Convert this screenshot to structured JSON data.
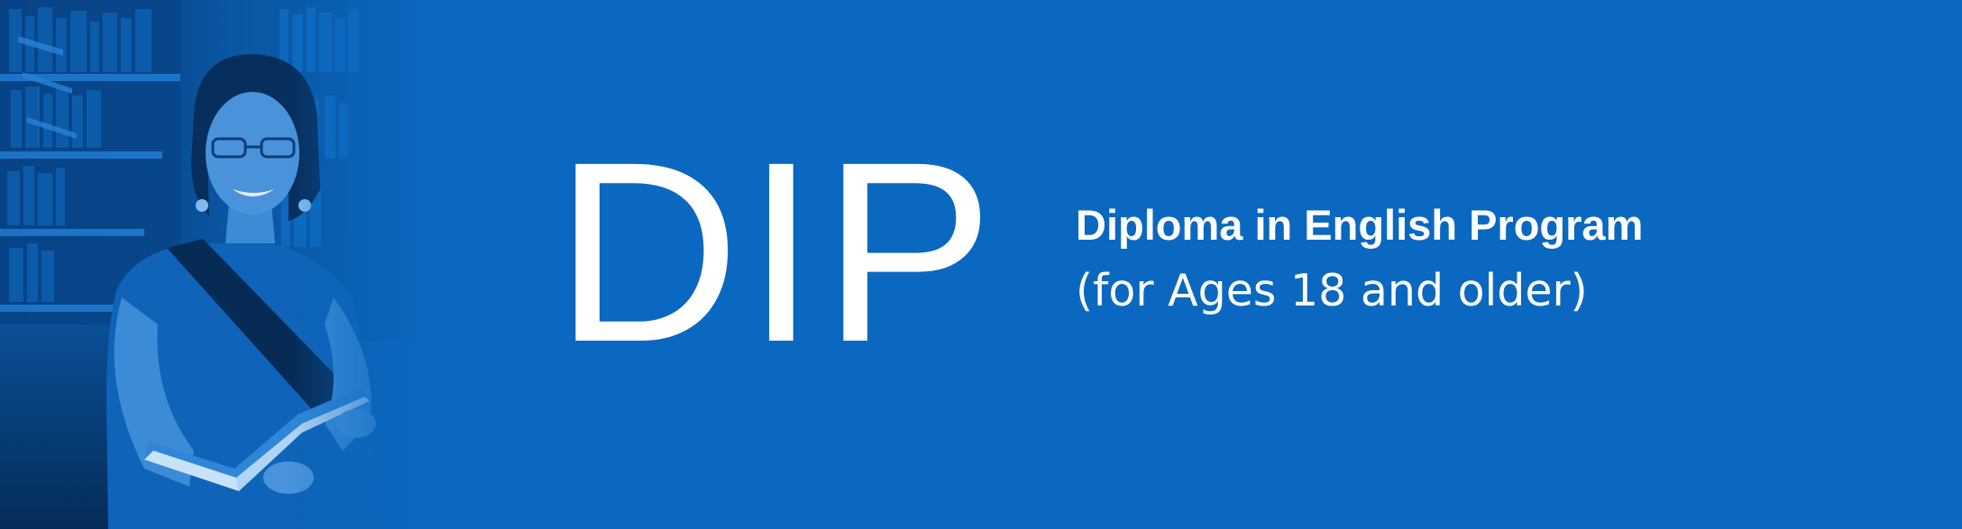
{
  "banner": {
    "acronym": "DIP",
    "title": "Diploma in English Program",
    "subtitle": "(for Ages 18 and older)",
    "background_color": "#0b68c0",
    "text_color": "#ffffff"
  },
  "photo": {
    "icon": "student-with-book-photo",
    "tint_color": "#0b68c0"
  }
}
